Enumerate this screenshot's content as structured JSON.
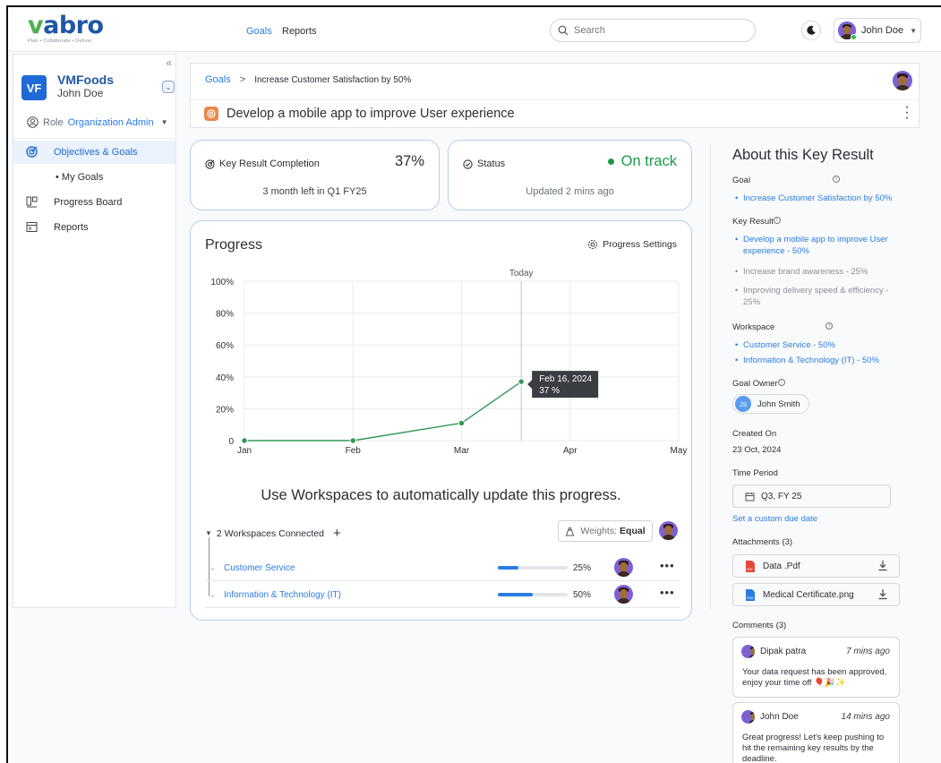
{
  "app": {
    "logo_text": "vabro",
    "logo_tagline": "Plan • Collaborate • Deliver"
  },
  "header": {
    "nav": [
      "Goals",
      "Reports"
    ],
    "search_placeholder": "Search",
    "user_name": "John Doe"
  },
  "sidebar": {
    "org_initials": "VF",
    "org_name": "VMFoods",
    "org_user": "John Doe",
    "role_label": "Role",
    "role_value": "Organization Admin",
    "items": [
      {
        "label": "Objectives & Goals",
        "icon": "target-icon",
        "active": true
      },
      {
        "label": "• My Goals",
        "icon": "",
        "active": false
      },
      {
        "label": "Progress Board",
        "icon": "board-icon",
        "active": false
      },
      {
        "label": "Reports",
        "icon": "report-icon",
        "active": false
      }
    ]
  },
  "breadcrumb": {
    "root": "Goals",
    "current": "Increase Customer Satisfaction by 50%"
  },
  "key_result_title": "Develop a mobile app to improve User experience",
  "kpis": {
    "completion_label": "Key Result Completion",
    "completion_value": "37%",
    "completion_sub": "3 month left in Q1 FY25",
    "status_label": "Status",
    "status_value": "On track",
    "status_sub": "Updated 2 mins ago"
  },
  "progress": {
    "title": "Progress",
    "settings_label": "Progress Settings",
    "workspace_hint": "Use Workspaces to automatically update this progress.",
    "workspaces_connected": "2 Workspaces Connected",
    "weights_label": "Weights:",
    "weights_value": "Equal",
    "workspaces": [
      {
        "name": "Customer Service",
        "percent": "25%",
        "fill": 0.3
      },
      {
        "name": "Information & Technology (IT)",
        "percent": "50%",
        "fill": 0.5
      }
    ]
  },
  "chart_data": {
    "type": "line",
    "x": [
      "Jan",
      "Feb",
      "Mar",
      "Apr",
      "May"
    ],
    "y_ticks": [
      "0",
      "20%",
      "40%",
      "60%",
      "80%",
      "100%"
    ],
    "points": [
      {
        "x": 0,
        "y": 0
      },
      {
        "x": 1,
        "y": 0
      },
      {
        "x": 2,
        "y": 11
      },
      {
        "x": 2.55,
        "y": 37
      }
    ],
    "ylim": [
      0,
      100
    ],
    "today_label": "Today",
    "today_x": 2.55,
    "tooltip_date": "Feb 16, 2024",
    "tooltip_value": "37 %",
    "line_color": "#2e9a52",
    "grid": true
  },
  "about": {
    "title": "About this Key Result",
    "goal_label": "Goal",
    "goal_value": "Increase Customer Satisfaction by 50%",
    "key_result_label": "Key Result",
    "key_results": [
      {
        "text": "Develop a mobile app to improve User experience - 50%",
        "current": true
      },
      {
        "text": "Increase brand awareness - 25%",
        "current": false
      },
      {
        "text": "Improving delivery speed & efficiency - 25%",
        "current": false
      }
    ],
    "workspace_label": "Workspace",
    "workspaces": [
      "Customer Service - 50%",
      "Information & Technology (IT) - 50%"
    ],
    "owner_label": "Goal Owner",
    "owner_initials": "JS",
    "owner_name": "John Smith",
    "created_label": "Created On",
    "created_value": "23 Oct, 2024",
    "period_label": "Time Period",
    "period_value": "Q3, FY 25",
    "custom_due_link": "Set a custom due date",
    "attachments_label": "Attachments (3)",
    "attachments": [
      "Data .Pdf",
      "Medical Certificate.png"
    ],
    "comments_label": "Comments (3)",
    "comments": [
      {
        "author": "Dipak patra",
        "time": "7 mins ago",
        "text": "Your data  request has been approved, enjoy your time off 🎈🎉✨"
      },
      {
        "author": "John Doe",
        "time": "14 mins ago",
        "text": "Great progress! Let's keep pushing to hit the remaining key results by the deadline."
      }
    ]
  },
  "colors": {
    "accent": "#2a7de1",
    "brand": "#1f57a5",
    "success": "#1d9a48"
  }
}
